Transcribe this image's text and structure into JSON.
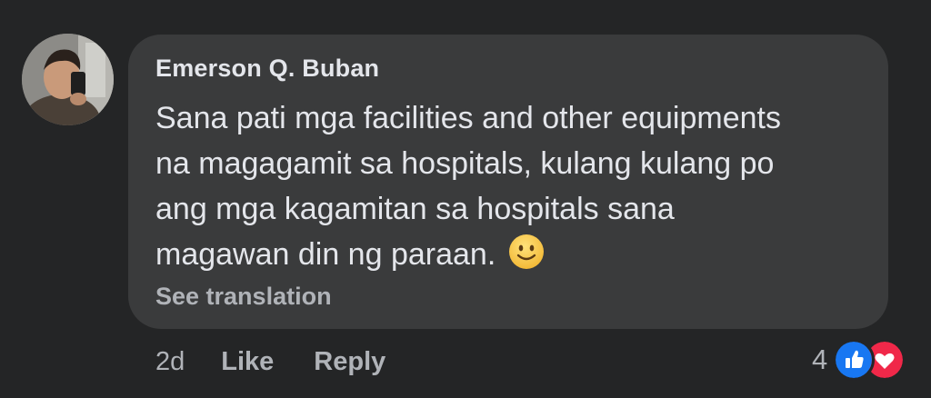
{
  "comment": {
    "author": "Emerson Q. Buban",
    "text_lines": [
      "Sana pati mga facilities and other equipments",
      "na magagamit sa hospitals, kulang kulang po",
      "ang mga kagamitan sa hospitals sana",
      "magawan din ng paraan."
    ],
    "emoji": "slightly-smiling-face-icon",
    "see_translation": "See translation"
  },
  "actions": {
    "time": "2d",
    "like": "Like",
    "reply": "Reply"
  },
  "reactions": {
    "count": "4",
    "icons": [
      "like-reaction-icon",
      "love-reaction-icon"
    ]
  },
  "colors": {
    "background": "#242526",
    "bubble": "#3a3b3c",
    "primary_text": "#e4e6eb",
    "secondary_text": "#b0b3b8",
    "like_blue": "#1877f2",
    "love_red": "#f02849",
    "emoji_yellow": "#f7c542"
  }
}
